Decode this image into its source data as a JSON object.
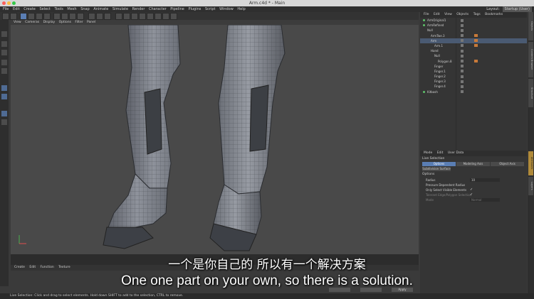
{
  "window": {
    "title": "Arm.c4d * - Main",
    "layout_label": "Layout:",
    "layout_value": "Startup (User)"
  },
  "menu": [
    "File",
    "Edit",
    "Create",
    "Select",
    "Tools",
    "Mesh",
    "Snap",
    "Animate",
    "Simulate",
    "Render",
    "Character",
    "Pipeline",
    "Plugins",
    "Script",
    "Window",
    "Help"
  ],
  "viewport_menu": [
    "View",
    "Cameras",
    "Display",
    "Options",
    "Filter",
    "Panel"
  ],
  "object_manager": {
    "menu": [
      "File",
      "Edit",
      "View",
      "Objects",
      "Tags",
      "Bookmarks"
    ],
    "objects": [
      {
        "name": "ArmOriginal1",
        "indent": 0,
        "dot": true
      },
      {
        "name": "ArmRefined",
        "indent": 0,
        "dot": true
      },
      {
        "name": "Null",
        "indent": 0,
        "dot": false
      },
      {
        "name": "ArmTwe.3",
        "indent": 1,
        "dot": false
      },
      {
        "name": "Arm",
        "indent": 1,
        "dot": false
      },
      {
        "name": "Arm.1",
        "indent": 2,
        "dot": false
      },
      {
        "name": "Hand",
        "indent": 1,
        "dot": false
      },
      {
        "name": "Null",
        "indent": 2,
        "dot": false
      },
      {
        "name": "Polygon.8",
        "indent": 3,
        "dot": false
      },
      {
        "name": "Finger",
        "indent": 2,
        "dot": false
      },
      {
        "name": "Finger.1",
        "indent": 2,
        "dot": false
      },
      {
        "name": "Finger.2",
        "indent": 2,
        "dot": false
      },
      {
        "name": "Finger.3",
        "indent": 2,
        "dot": false
      },
      {
        "name": "Finger.4",
        "indent": 2,
        "dot": false
      },
      {
        "name": "Kitbash",
        "indent": 0,
        "dot": true
      }
    ]
  },
  "attribute_manager": {
    "menu": [
      "Mode",
      "Edit",
      "User Data"
    ],
    "title": "Live Selection",
    "tabs": [
      "Options",
      "Modeling Axis",
      "Object Axis"
    ],
    "active_tab": "Options",
    "subtab": "Subdivision Surface",
    "section": "Options",
    "rows": [
      {
        "label": "Radius",
        "value": "10",
        "type": "field",
        "dim": false
      },
      {
        "label": "Pressure Dependent Radius",
        "value": "",
        "type": "check",
        "dim": false
      },
      {
        "label": "Only Select Visible Elements",
        "value": "✓",
        "type": "check",
        "dim": false
      },
      {
        "label": "Tolerant Edge/Polygon Selection",
        "value": "✓",
        "type": "check",
        "dim": true
      },
      {
        "label": "Mode",
        "value": "Normal",
        "type": "field",
        "dim": true
      }
    ]
  },
  "side_tabs": [
    "Objects",
    "Content Browser",
    "Structure",
    "Attributes",
    "Layers"
  ],
  "material_menu": [
    "Create",
    "Edit",
    "Function",
    "Texture"
  ],
  "apply_button": "Apply",
  "statusbar": "Live Selection: Click and drag to select elements. Hold down SHIFT to add to the selection, CTRL to remove.",
  "subtitles": {
    "chinese": "一个是你自己的  所以有一个解决方案",
    "english": "One one part on your own, so there is a solution."
  }
}
